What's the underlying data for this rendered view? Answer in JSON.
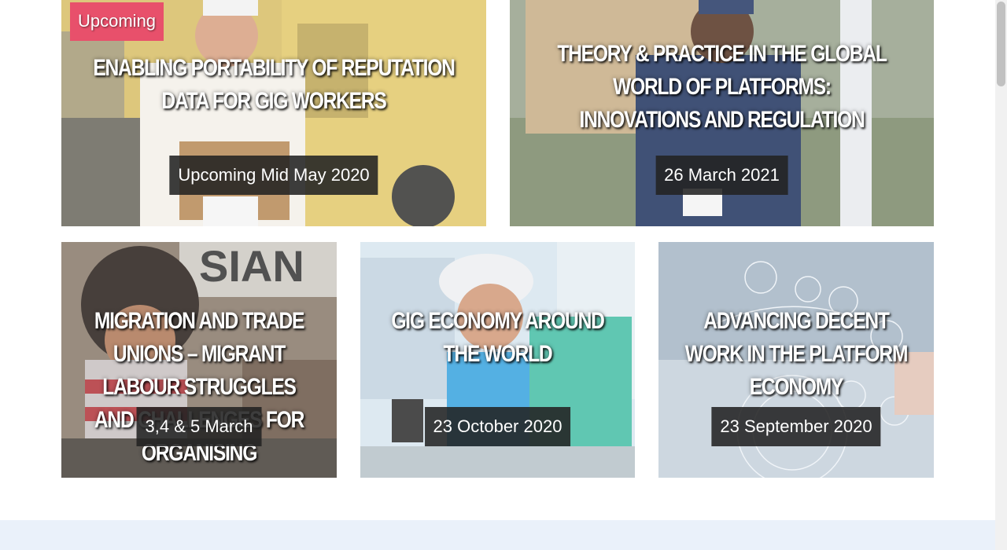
{
  "cards": [
    {
      "badge": "Upcoming",
      "title": "ENABLING PORTABILITY OF REPUTATION DATA FOR GIG WORKERS",
      "date": "Upcoming Mid May 2020"
    },
    {
      "title_lines": [
        "THEORY & PRACTICE IN THE GLOBAL WORLD OF PLATFORMS:",
        "INNOVATIONS AND REGULATION"
      ],
      "date": "26 March 2021"
    },
    {
      "title": "MIGRATION AND TRADE UNIONS – MIGRANT LABOUR STRUGGLES AND CHALLENGES FOR ORGANISING",
      "date": "3,4 & 5 March"
    },
    {
      "title": "GIG ECONOMY AROUND THE WORLD",
      "date": "23 October 2020"
    },
    {
      "title": "ADVANCING DECENT WORK IN THE PLATFORM ECONOMY",
      "date": "23 September 2020"
    }
  ],
  "colors": {
    "badge": "#e8506b",
    "date_bg": "#222222",
    "footer_band": "#eaf1fa"
  }
}
